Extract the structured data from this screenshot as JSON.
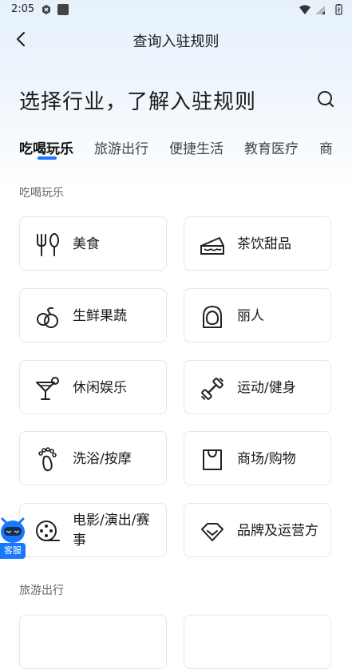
{
  "status_bar": {
    "time": "2:05"
  },
  "nav": {
    "title": "查询入驻规则"
  },
  "headline": "选择行业，了解入驻规则",
  "tabs": [
    {
      "label": "吃喝玩乐",
      "active": true
    },
    {
      "label": "旅游出行"
    },
    {
      "label": "便捷生活"
    },
    {
      "label": "教育医疗"
    },
    {
      "label": "商"
    }
  ],
  "sections": [
    {
      "title": "吃喝玩乐",
      "cards": [
        {
          "label": "美食",
          "icon": "utensils-icon"
        },
        {
          "label": "茶饮甜品",
          "icon": "cake-icon"
        },
        {
          "label": "生鲜果蔬",
          "icon": "fruit-icon"
        },
        {
          "label": "丽人",
          "icon": "beauty-icon"
        },
        {
          "label": "休闲娱乐",
          "icon": "cocktail-icon"
        },
        {
          "label": "运动/健身",
          "icon": "dumbbell-icon"
        },
        {
          "label": "洗浴/按摩",
          "icon": "footprint-icon"
        },
        {
          "label": "商场/购物",
          "icon": "shopping-bag-icon"
        },
        {
          "label": "电影/演出/赛事",
          "icon": "film-reel-icon"
        },
        {
          "label": "品牌及运营方",
          "icon": "diamond-icon"
        }
      ]
    },
    {
      "title": "旅游出行"
    }
  ],
  "customer_service": {
    "label": "客服"
  },
  "colors": {
    "accent": "#1677ff",
    "card_border": "#e6e6e6"
  }
}
